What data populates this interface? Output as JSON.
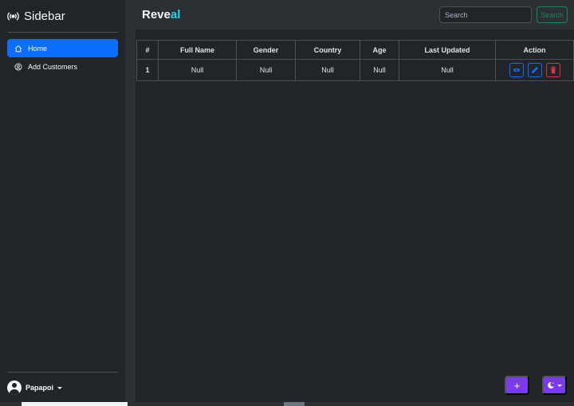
{
  "sidebar": {
    "brand": "Sidebar",
    "items": [
      {
        "label": "Home",
        "active": true,
        "icon": "home-icon"
      },
      {
        "label": "Add Customers",
        "active": false,
        "icon": "user-circle-icon"
      }
    ],
    "user": {
      "name": "Papapoi"
    }
  },
  "header": {
    "logo_main": "Reve",
    "logo_highlight": "al",
    "search_placeholder": "Search",
    "search_button": "Search"
  },
  "table": {
    "columns": [
      "#",
      "Full Name",
      "Gender",
      "Country",
      "Age",
      "Last Updated",
      "Action"
    ],
    "rows": [
      {
        "num": "1",
        "full_name": "Null",
        "gender": "Null",
        "country": "Null",
        "age": "Null",
        "last_updated": "Null"
      }
    ]
  },
  "fab": {
    "add_label": "+"
  },
  "colors": {
    "bg": "#212529",
    "primary": "#0d6efd",
    "success": "#198754",
    "danger": "#dc3545",
    "accent": "#7c3aed",
    "logo_highlight": "#22d3ee"
  }
}
